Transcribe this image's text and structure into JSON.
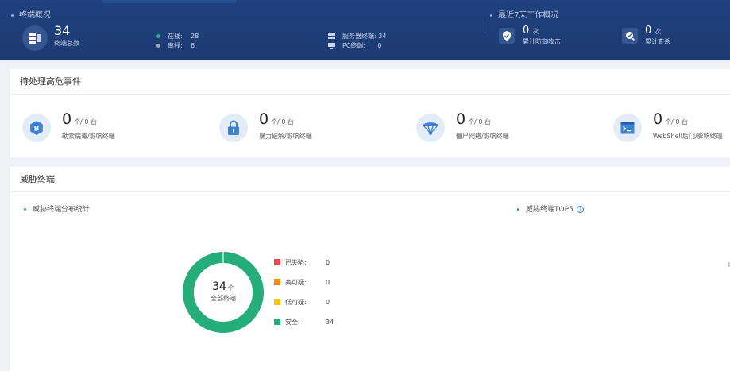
{
  "header": {
    "overview_title": "终端概况",
    "total_count": "34",
    "total_label": "终端总数",
    "online_label": "在线:",
    "online_value": "28",
    "offline_label": "离线:",
    "offline_value": "6",
    "server_label": "服务器终端:",
    "server_value": "34",
    "pc_label": "PC终端:",
    "pc_value": "0",
    "weekly_title": "最近7天工作概况",
    "defense_count": "0",
    "defense_unit": "次",
    "defense_label": "累计防御攻击",
    "scan_count": "0",
    "scan_unit": "次",
    "scan_label": "累计查杀"
  },
  "events": {
    "title": "待处理高危事件",
    "items": [
      {
        "count": "0",
        "unit": "个/ 0 台",
        "label": "勒索病毒/影响终端",
        "icon": "bitcoin-icon"
      },
      {
        "count": "0",
        "unit": "个/ 0 台",
        "label": "暴力破解/影响终端",
        "icon": "lock-icon"
      },
      {
        "count": "0",
        "unit": "个/ 0 台",
        "label": "僵尸网络/影响终端",
        "icon": "botnet-icon"
      },
      {
        "count": "0",
        "unit": "个/ 0 台",
        "label": "WebShell后门/影响终端",
        "icon": "terminal-icon"
      }
    ]
  },
  "threat": {
    "title": "威胁终端",
    "distribution_title": "威胁终端分布统计",
    "top5_title": "威胁终端TOP5",
    "info_glyph": "i",
    "donut_total": "34",
    "donut_unit": "个",
    "donut_label": "全部终端",
    "legend": [
      {
        "label": "已失陷:",
        "value": "0",
        "color": "#e84c4c"
      },
      {
        "label": "高可疑:",
        "value": "0",
        "color": "#f08c00"
      },
      {
        "label": "低可疑:",
        "value": "0",
        "color": "#f5c400"
      },
      {
        "label": "安全:",
        "value": "34",
        "color": "#25ad7a"
      }
    ]
  },
  "colors": {
    "header_bg": "#1e3e78",
    "online_dot": "#25ad7a",
    "offline_dot": "#a0a8b4",
    "accent": "#3b82d4",
    "safe_green": "#25ad7a"
  }
}
